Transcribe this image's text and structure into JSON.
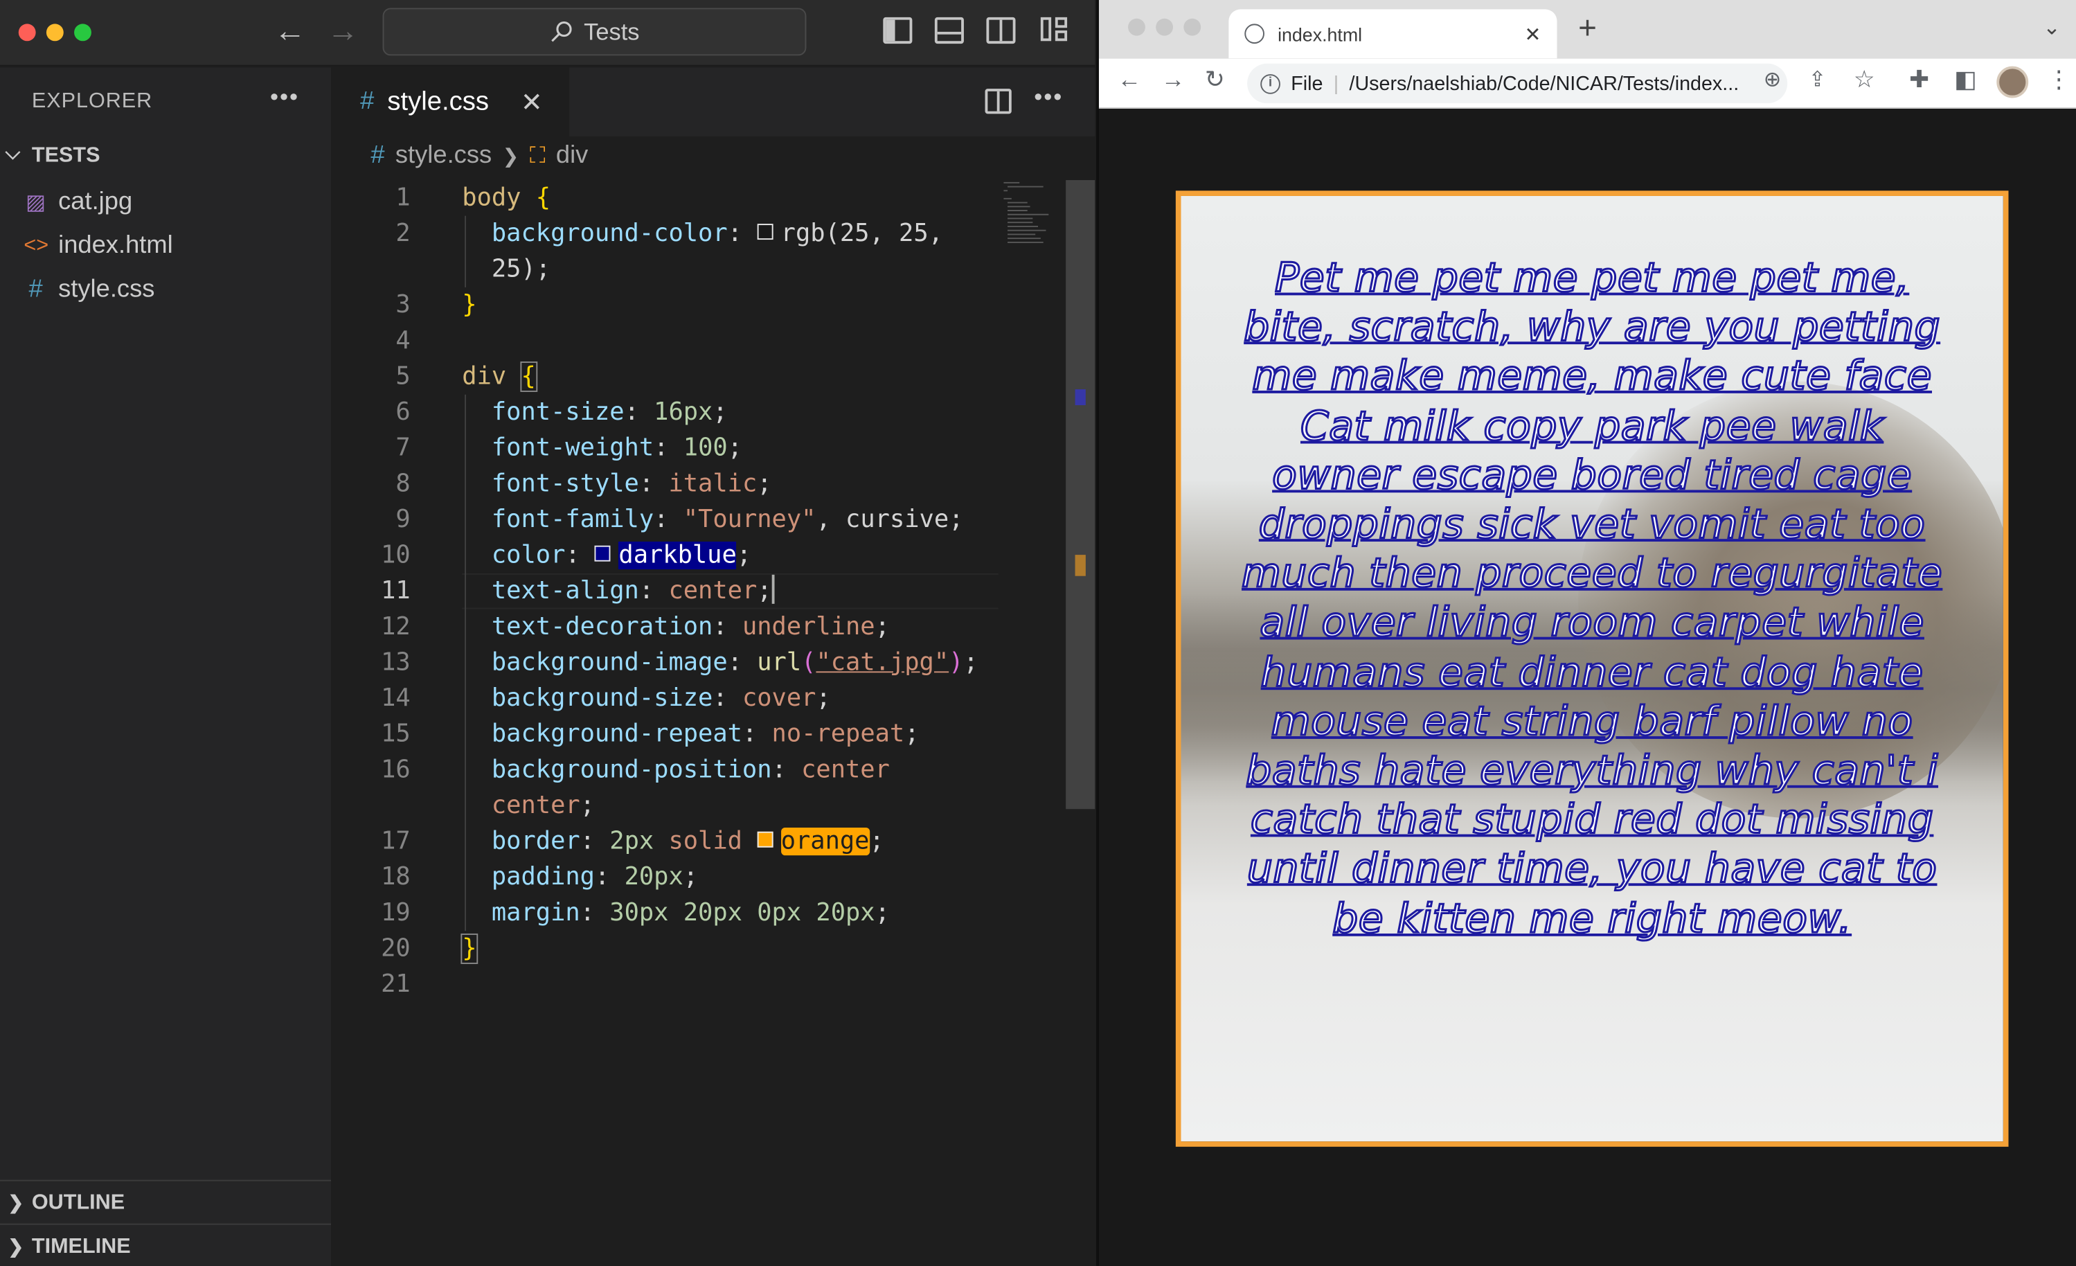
{
  "vscode": {
    "command_center": "Tests",
    "explorer": {
      "title": "EXPLORER",
      "folder": "TESTS",
      "files": [
        {
          "name": "cat.jpg",
          "icon": "image-file-icon"
        },
        {
          "name": "index.html",
          "icon": "html-file-icon"
        },
        {
          "name": "style.css",
          "icon": "css-file-icon"
        }
      ],
      "outline": "OUTLINE",
      "timeline": "TIMELINE"
    },
    "tab": {
      "label": "style.css"
    },
    "breadcrumb": {
      "file": "style.css",
      "symbol": "div"
    },
    "current_line": 11,
    "lines": {
      "n1": "1",
      "n2": "2",
      "n3": "3",
      "n4": "4",
      "n5": "5",
      "n6": "6",
      "n7": "7",
      "n8": "8",
      "n9": "9",
      "n10": "10",
      "n11": "11",
      "n12": "12",
      "n13": "13",
      "n14": "14",
      "n15": "15",
      "n16": "16",
      "n17": "17",
      "n18": "18",
      "n19": "19",
      "n20": "20",
      "n21": "21"
    },
    "code": {
      "body_sel": "body",
      "open": "{",
      "close": "}",
      "bg_prop": "background-color",
      "bg_val_a": "rgb(25, 25,",
      "bg_val_b": "25);",
      "div_sel": "div",
      "l6_prop": "font-size",
      "l6_val": "16px",
      "l7_prop": "font-weight",
      "l7_val": "100",
      "l8_prop": "font-style",
      "l8_val": "italic",
      "l9_prop": "font-family",
      "l9_val": "\"Tourney\"",
      "l9_val2": "cursive",
      "l10_prop": "color",
      "l10_val": "darkblue",
      "l11_prop": "text-align",
      "l11_val": "center",
      "l12_prop": "text-decoration",
      "l12_val": "underline",
      "l13_prop": "background-image",
      "l13_fn": "url",
      "l13_str": "\"cat.jpg\"",
      "l14_prop": "background-size",
      "l14_val": "cover",
      "l15_prop": "background-repeat",
      "l15_val": "no-repeat",
      "l16_prop": "background-position",
      "l16_val": "center",
      "l16_val2": "center",
      "l17_prop": "border",
      "l17_n": "2px",
      "l17_val": "solid",
      "l17_color": "orange",
      "l18_prop": "padding",
      "l18_val": "20px",
      "l19_prop": "margin",
      "l19_val": "30px 20px 0px 20px"
    },
    "colors": {
      "accent": "#0078d4",
      "darkblue": "#00008b",
      "orange": "#ffa500"
    }
  },
  "browser": {
    "tab_title": "index.html",
    "address_scheme": "File",
    "address": "/Users/naelshiab/Code/NICAR/Tests/index...",
    "page_text": "Pet me pet me pet me pet me, bite, scratch, why are you petting me make meme, make cute face Cat milk copy park pee walk owner escape bored tired cage droppings sick vet vomit eat too much then proceed to regurgitate all over living room carpet while humans eat dinner cat dog hate mouse eat string barf pillow no baths hate everything why can't i catch that stupid red dot missing until dinner time, you have cat to be kitten me right meow.",
    "border_color": "#f4a137",
    "text_color": "#1d1aa0"
  }
}
